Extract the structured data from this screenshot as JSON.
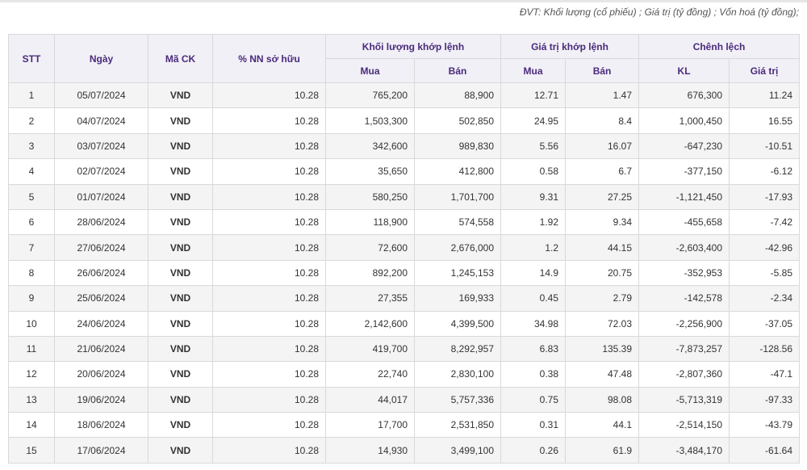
{
  "note": "ĐVT: Khối lượng (cổ phiếu) ; Giá trị (tỷ đồng) ; Vốn hoá (tỷ đồng);",
  "headers": {
    "stt": "STT",
    "date": "Ngày",
    "code": "Mã CK",
    "foreign_pct": "% NN sở hữu",
    "volume_group": "Khối lượng khớp lệnh",
    "value_group": "Giá trị khớp lệnh",
    "diff_group": "Chênh lệch",
    "buy": "Mua",
    "sell": "Bán",
    "diff_volume": "KL",
    "diff_value": "Giá trị"
  },
  "rows": [
    {
      "stt": "1",
      "date": "05/07/2024",
      "code": "VND",
      "pct": "10.28",
      "vol_buy": "765,200",
      "vol_sell": "88,900",
      "val_buy": "12.71",
      "val_sell": "1.47",
      "diff_vol": "676,300",
      "diff_val": "11.24"
    },
    {
      "stt": "2",
      "date": "04/07/2024",
      "code": "VND",
      "pct": "10.28",
      "vol_buy": "1,503,300",
      "vol_sell": "502,850",
      "val_buy": "24.95",
      "val_sell": "8.4",
      "diff_vol": "1,000,450",
      "diff_val": "16.55"
    },
    {
      "stt": "3",
      "date": "03/07/2024",
      "code": "VND",
      "pct": "10.28",
      "vol_buy": "342,600",
      "vol_sell": "989,830",
      "val_buy": "5.56",
      "val_sell": "16.07",
      "diff_vol": "-647,230",
      "diff_val": "-10.51"
    },
    {
      "stt": "4",
      "date": "02/07/2024",
      "code": "VND",
      "pct": "10.28",
      "vol_buy": "35,650",
      "vol_sell": "412,800",
      "val_buy": "0.58",
      "val_sell": "6.7",
      "diff_vol": "-377,150",
      "diff_val": "-6.12"
    },
    {
      "stt": "5",
      "date": "01/07/2024",
      "code": "VND",
      "pct": "10.28",
      "vol_buy": "580,250",
      "vol_sell": "1,701,700",
      "val_buy": "9.31",
      "val_sell": "27.25",
      "diff_vol": "-1,121,450",
      "diff_val": "-17.93"
    },
    {
      "stt": "6",
      "date": "28/06/2024",
      "code": "VND",
      "pct": "10.28",
      "vol_buy": "118,900",
      "vol_sell": "574,558",
      "val_buy": "1.92",
      "val_sell": "9.34",
      "diff_vol": "-455,658",
      "diff_val": "-7.42"
    },
    {
      "stt": "7",
      "date": "27/06/2024",
      "code": "VND",
      "pct": "10.28",
      "vol_buy": "72,600",
      "vol_sell": "2,676,000",
      "val_buy": "1.2",
      "val_sell": "44.15",
      "diff_vol": "-2,603,400",
      "diff_val": "-42.96"
    },
    {
      "stt": "8",
      "date": "26/06/2024",
      "code": "VND",
      "pct": "10.28",
      "vol_buy": "892,200",
      "vol_sell": "1,245,153",
      "val_buy": "14.9",
      "val_sell": "20.75",
      "diff_vol": "-352,953",
      "diff_val": "-5.85"
    },
    {
      "stt": "9",
      "date": "25/06/2024",
      "code": "VND",
      "pct": "10.28",
      "vol_buy": "27,355",
      "vol_sell": "169,933",
      "val_buy": "0.45",
      "val_sell": "2.79",
      "diff_vol": "-142,578",
      "diff_val": "-2.34"
    },
    {
      "stt": "10",
      "date": "24/06/2024",
      "code": "VND",
      "pct": "10.28",
      "vol_buy": "2,142,600",
      "vol_sell": "4,399,500",
      "val_buy": "34.98",
      "val_sell": "72.03",
      "diff_vol": "-2,256,900",
      "diff_val": "-37.05"
    },
    {
      "stt": "11",
      "date": "21/06/2024",
      "code": "VND",
      "pct": "10.28",
      "vol_buy": "419,700",
      "vol_sell": "8,292,957",
      "val_buy": "6.83",
      "val_sell": "135.39",
      "diff_vol": "-7,873,257",
      "diff_val": "-128.56"
    },
    {
      "stt": "12",
      "date": "20/06/2024",
      "code": "VND",
      "pct": "10.28",
      "vol_buy": "22,740",
      "vol_sell": "2,830,100",
      "val_buy": "0.38",
      "val_sell": "47.48",
      "diff_vol": "-2,807,360",
      "diff_val": "-47.1"
    },
    {
      "stt": "13",
      "date": "19/06/2024",
      "code": "VND",
      "pct": "10.28",
      "vol_buy": "44,017",
      "vol_sell": "5,757,336",
      "val_buy": "0.75",
      "val_sell": "98.08",
      "diff_vol": "-5,713,319",
      "diff_val": "-97.33"
    },
    {
      "stt": "14",
      "date": "18/06/2024",
      "code": "VND",
      "pct": "10.28",
      "vol_buy": "17,700",
      "vol_sell": "2,531,850",
      "val_buy": "0.31",
      "val_sell": "44.1",
      "diff_vol": "-2,514,150",
      "diff_val": "-43.79"
    },
    {
      "stt": "15",
      "date": "17/06/2024",
      "code": "VND",
      "pct": "10.28",
      "vol_buy": "14,930",
      "vol_sell": "3,499,100",
      "val_buy": "0.26",
      "val_sell": "61.9",
      "diff_vol": "-3,484,170",
      "diff_val": "-61.64"
    }
  ],
  "colors": {
    "header_text": "#4a2a7c",
    "header_bg": "#f1f0f6",
    "stripe_bg": "#f4f4f4",
    "border": "#d9d9d9"
  }
}
